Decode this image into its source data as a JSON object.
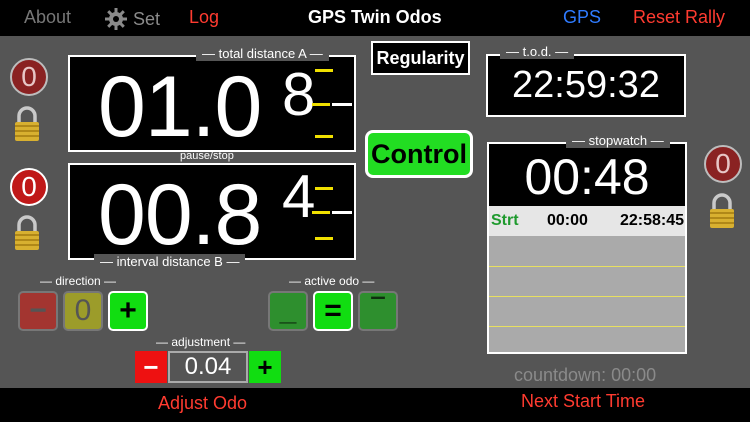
{
  "topbar": {
    "about": "About",
    "set": "Set",
    "log": "Log",
    "title": "GPS Twin Odos",
    "gps": "GPS",
    "reset": "Reset Rally"
  },
  "odo_a": {
    "label": "total distance A",
    "value": "01.0",
    "roll_digit": "8",
    "zero": "0"
  },
  "pause_label": "pause/stop",
  "odo_b": {
    "label": "interval distance B",
    "value": "00.8",
    "roll_digit": "4",
    "zero": "0"
  },
  "regularity": "Regularity",
  "control": "Control",
  "tod": {
    "label": "t.o.d.",
    "value": "22:59:32"
  },
  "stopwatch": {
    "label": "stopwatch",
    "value": "00:48",
    "row": {
      "strt": "Strt",
      "t1": "00:00",
      "t2": "22:58:45"
    },
    "zero": "0"
  },
  "countdown": "countdown: 00:00",
  "direction": {
    "label": "direction",
    "minus": "−",
    "zero": "0",
    "plus": "+"
  },
  "active_odo": {
    "label": "active odo",
    "a": "_",
    "eq": "=",
    "b": "‾"
  },
  "adjustment": {
    "label": "adjustment",
    "minus": "−",
    "value": "0.04",
    "plus": "+"
  },
  "bottombar": {
    "adjust_odo": "Adjust Odo",
    "next_start": "Next Start Time"
  },
  "colors": {
    "accent_red": "#ff3b30",
    "gps_blue": "#2f7bff",
    "active_green": "#11dd11",
    "background": "#555555"
  }
}
